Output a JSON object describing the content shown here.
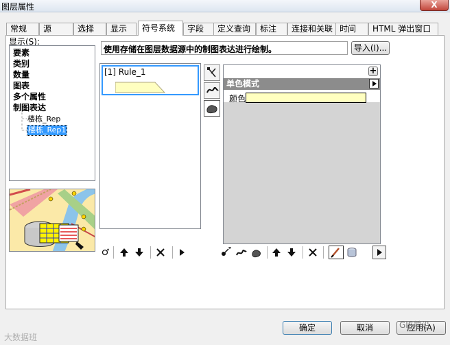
{
  "window": {
    "title": "图层属性",
    "close_label": "X"
  },
  "tabs": [
    "常规",
    "源",
    "选择",
    "显示",
    "符号系统",
    "字段",
    "定义查询",
    "标注",
    "连接和关联",
    "时间",
    "HTML 弹出窗口"
  ],
  "active_tab": "符号系统",
  "show_label": "显示(S):",
  "tree": {
    "categories": [
      "要素",
      "类别",
      "数量",
      "图表",
      "多个属性",
      "制图表达"
    ],
    "children": [
      "楼栋_Rep",
      "楼栋_Rep1"
    ],
    "selected": "楼栋_Rep1"
  },
  "description": "使用存储在图层数据源中的制图表达进行绘制。",
  "import_button": "导入(I)...",
  "rules": [
    {
      "label": "[1] Rule_1"
    }
  ],
  "layer_panel": {
    "add_label": "+",
    "section_title": "单色模式",
    "color_label": "颜色:",
    "color_value": "#ffffc0"
  },
  "footer": {
    "ok": "确定",
    "cancel": "取消",
    "apply": "应用(A)"
  },
  "watermarks": {
    "left": "大数据班",
    "right": "GIS前沿"
  }
}
